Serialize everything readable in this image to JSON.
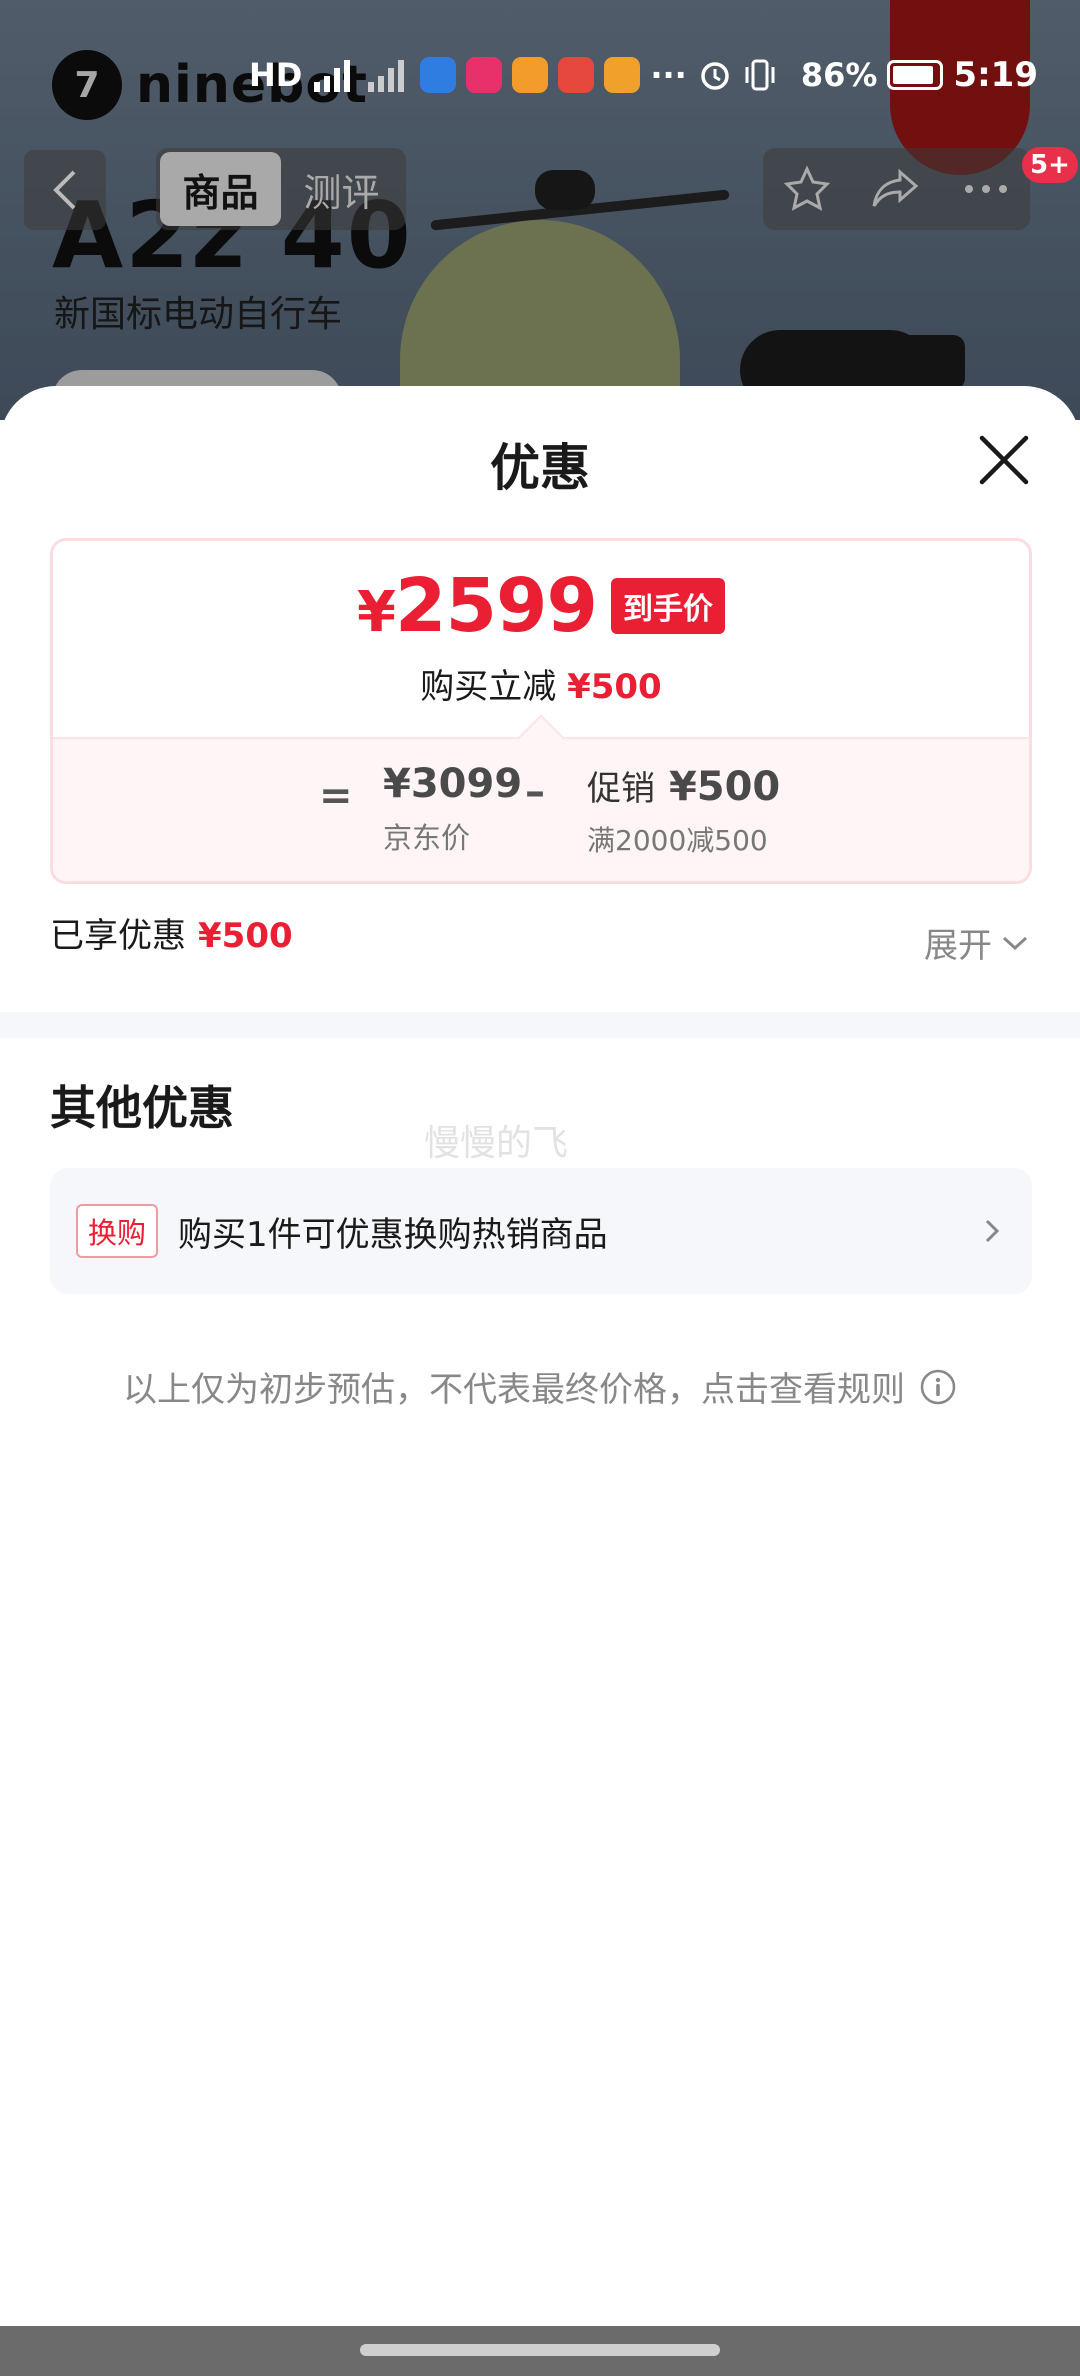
{
  "status_bar": {
    "icons": [
      "hd-icon",
      "signal-icon",
      "signal-icon",
      "app-icon",
      "app-icon",
      "app-icon",
      "app-icon",
      "app-icon",
      "more-icon",
      "alarm-icon",
      "vibrate-icon",
      "battery-icon"
    ],
    "battery_percent": "86%",
    "time": "5:19"
  },
  "background_page": {
    "brand_name": "ninebot",
    "model": "A2z 40",
    "model_subtitle": "新国标电动自行车",
    "nav": {
      "back_icon": "chevron-left-icon",
      "tabs": [
        {
          "label": "商品",
          "active": true
        },
        {
          "label": "测评",
          "active": false
        }
      ],
      "actions": [
        "star-icon",
        "share-icon",
        "more-icon"
      ],
      "badge": "5+"
    }
  },
  "sheet": {
    "title": "优惠",
    "close_icon": "close-icon",
    "price_card": {
      "currency": "¥",
      "final_price": "2599",
      "final_badge": "到手价",
      "instant_discount_label": "购买立减",
      "instant_discount_value": "¥500",
      "equals_sign": "=",
      "jd_price": "¥3099",
      "jd_price_label": "京东价",
      "minus_sign": "–",
      "promo_label": "促销",
      "promo_value": "¥500",
      "promo_condition": "满2000减500"
    },
    "enjoyed": {
      "label": "已享优惠",
      "value": "¥500"
    },
    "expand_label": "展开",
    "other_offers_title": "其他优惠",
    "watermark": "慢慢的飞",
    "offers": [
      {
        "tag": "换购",
        "text": "购买1件可优惠换购热销商品"
      }
    ],
    "disclaimer": "以上仅为初步预估，不代表最终价格，点击查看规则"
  },
  "colors": {
    "accent_red": "#ea1f33",
    "badge_pink": "#e8304a",
    "card_border": "#fbdde1",
    "card_tint": "#fff5f6",
    "offer_bg": "#f6f7fb"
  }
}
